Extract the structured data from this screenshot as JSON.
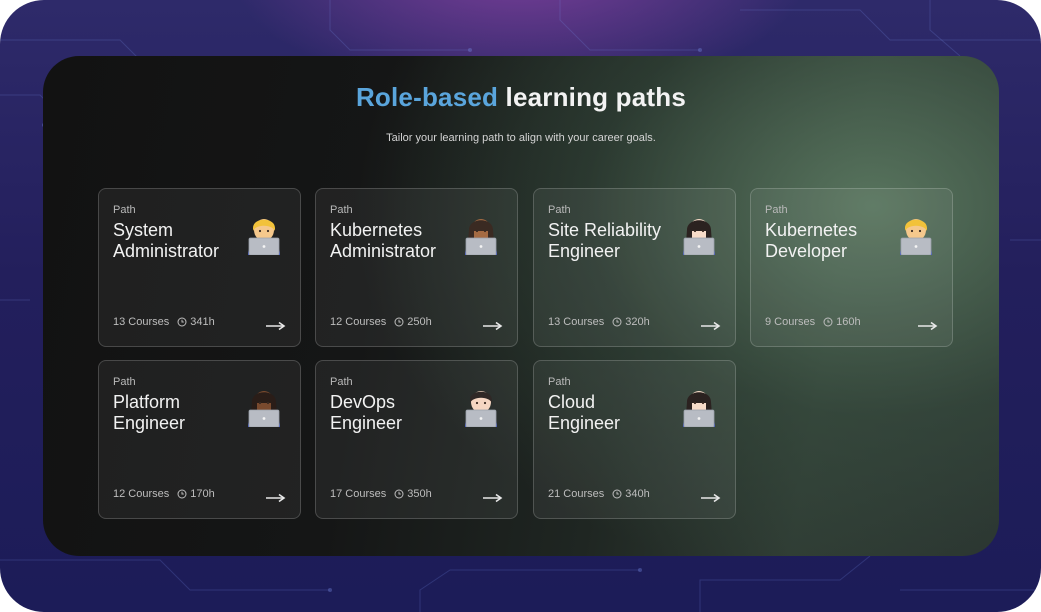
{
  "header": {
    "title_accent": "Role-based",
    "title_rest": " learning paths",
    "subtitle": "Tailor your learning path to align with your career goals."
  },
  "colors": {
    "accent": "#5aa5dc"
  },
  "paths": [
    {
      "kicker": "Path",
      "line1": "System",
      "line2": "Administrator",
      "courses": "13 Courses",
      "hours": "341h",
      "avatar": "man-technologist-blond-icon"
    },
    {
      "kicker": "Path",
      "line1": "Kubernetes",
      "line2": "Administrator",
      "courses": "12 Courses",
      "hours": "250h",
      "avatar": "woman-technologist-medium-dark-icon"
    },
    {
      "kicker": "Path",
      "line1": "Site Reliability",
      "line2": "Engineer",
      "courses": "13 Courses",
      "hours": "320h",
      "avatar": "woman-technologist-light-icon"
    },
    {
      "kicker": "Path",
      "line1": "Kubernetes",
      "line2": "Developer",
      "courses": "9 Courses",
      "hours": "160h",
      "avatar": "man-technologist-blond-icon"
    },
    {
      "kicker": "Path",
      "line1": "Platform",
      "line2": "Engineer",
      "courses": "12 Courses",
      "hours": "170h",
      "avatar": "woman-technologist-dark-icon"
    },
    {
      "kicker": "Path",
      "line1": "DevOps",
      "line2": "Engineer",
      "courses": "17 Courses",
      "hours": "350h",
      "avatar": "man-technologist-light-icon"
    },
    {
      "kicker": "Path",
      "line1": "Cloud",
      "line2": "Engineer",
      "courses": "21 Courses",
      "hours": "340h",
      "avatar": "woman-technologist-light-icon"
    }
  ]
}
